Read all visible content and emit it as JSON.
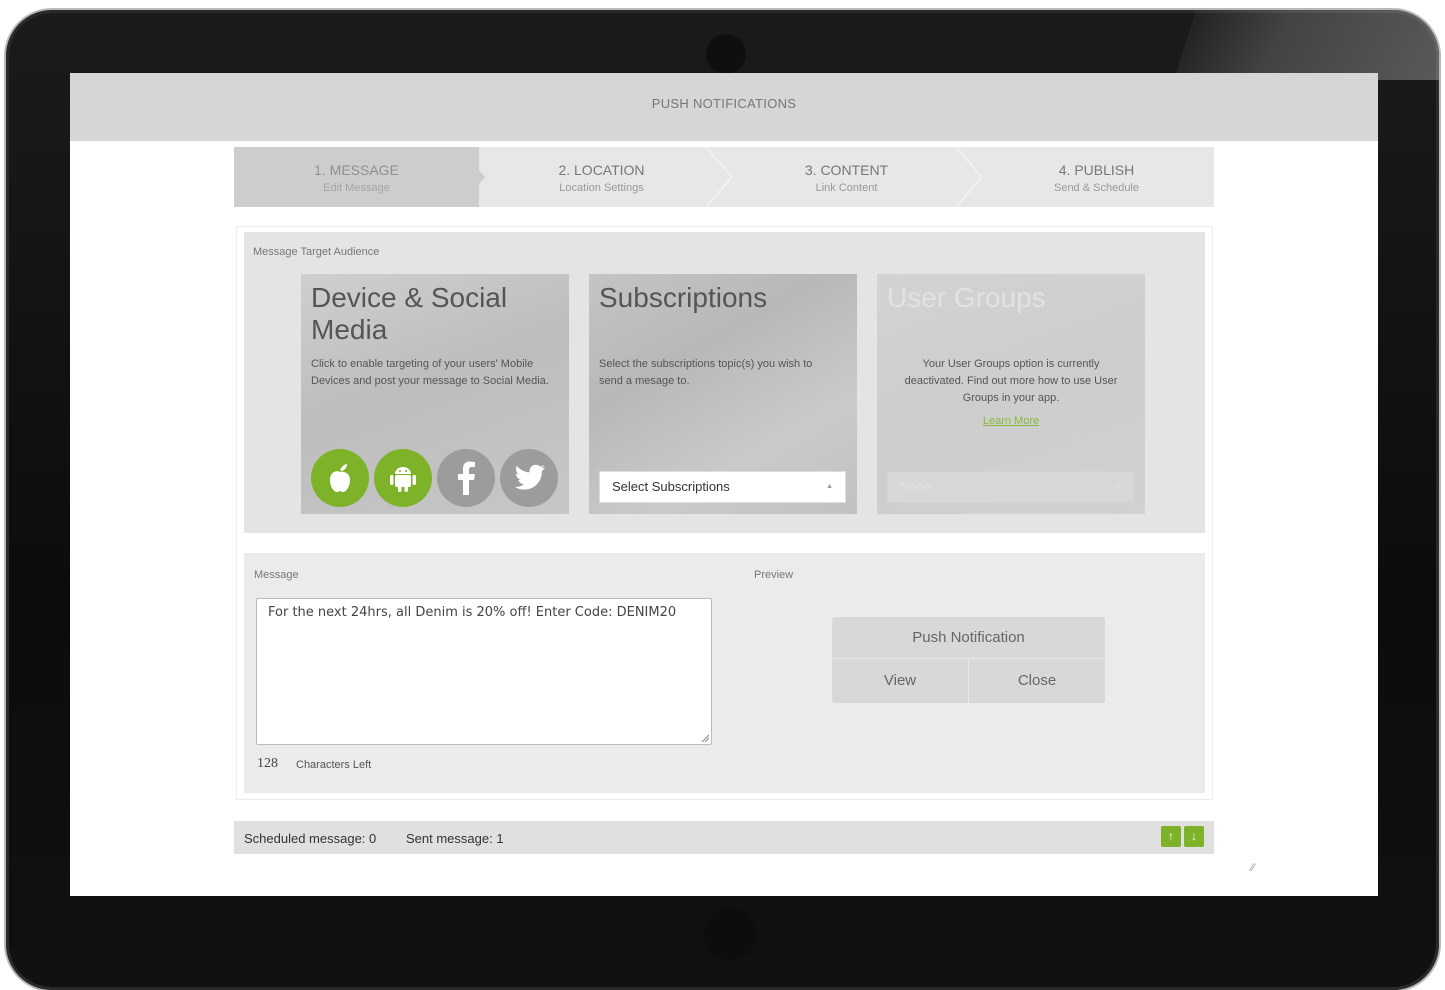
{
  "app": {
    "title": "PUSH NOTIFICATIONS"
  },
  "steps": [
    {
      "title": "1. MESSAGE",
      "subtitle": "Edit Message"
    },
    {
      "title": "2. LOCATION",
      "subtitle": "Location Settings"
    },
    {
      "title": "3. CONTENT",
      "subtitle": "Link Content"
    },
    {
      "title": "4. PUBLISH",
      "subtitle": "Send & Schedule"
    }
  ],
  "audience": {
    "label": "Message Target Audience",
    "device_social": {
      "title": "Device & Social Media",
      "description": "Click to enable targeting of your users' Mobile Devices and post your message to Social Media.",
      "icons": [
        "apple-icon",
        "android-icon",
        "facebook-icon",
        "twitter-icon"
      ]
    },
    "subscriptions": {
      "title": "Subscriptions",
      "description": "Select the subscriptions topic(s) you wish to send a mesage to.",
      "select_value": "Select Subscriptions"
    },
    "user_groups": {
      "title": "User Groups",
      "description": "Your User Groups option is currently deactivated. Find out more how to use User Groups in your app.",
      "link": "Learn More",
      "select_value": "None"
    }
  },
  "message": {
    "label": "Message",
    "text": "For the next 24hrs, all Denim is 20% off! Enter Code: DENIM20",
    "chars_left": "128",
    "chars_left_label": "Characters Left"
  },
  "preview": {
    "label": "Preview",
    "title": "Push Notification",
    "view_label": "View",
    "close_label": "Close"
  },
  "status": {
    "scheduled": "Scheduled message: 0",
    "sent": "Sent message: 1",
    "up": "↑",
    "down": "↓"
  },
  "colors": {
    "accent": "#7db229",
    "disabled_icon": "#9c9c9c"
  }
}
